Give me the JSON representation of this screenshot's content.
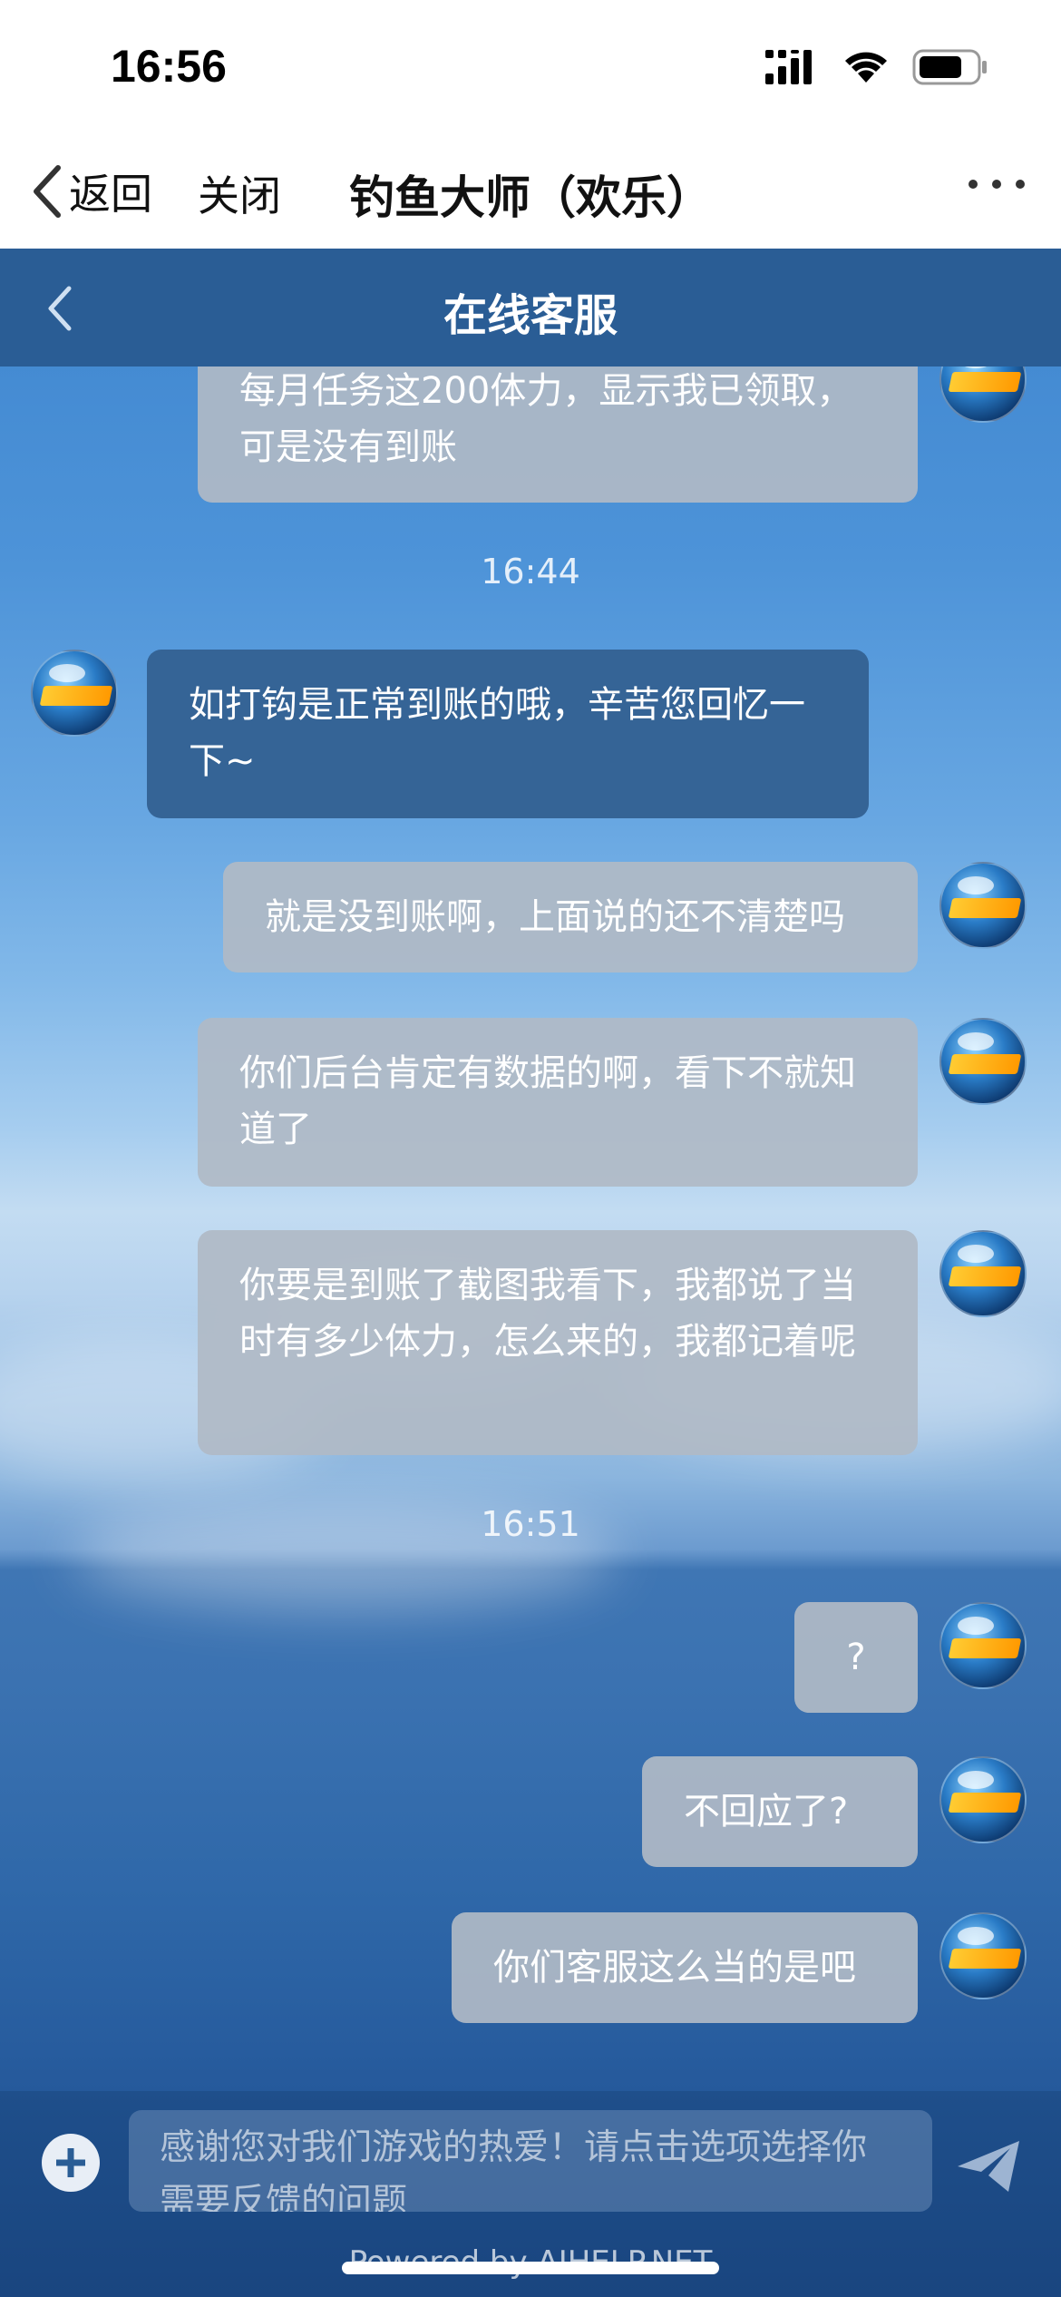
{
  "status_bar": {
    "time": "16:56"
  },
  "nav": {
    "back_label": "返回",
    "close_label": "关闭",
    "title": "钓鱼大师（欢乐）"
  },
  "header": {
    "title": "在线客服"
  },
  "messages": [
    {
      "sender": "user",
      "text": "每月任务这200体力，显示我已领取，可是没有到账"
    },
    {
      "sender": "agent",
      "text": "如打钩是正常到账的哦，辛苦您回忆一下~"
    },
    {
      "sender": "user",
      "text": "就是没到账啊，上面说的还不清楚吗"
    },
    {
      "sender": "user",
      "text": "你们后台肯定有数据的啊，看下不就知道了"
    },
    {
      "sender": "user",
      "text": "你要是到账了截图我看下，我都说了当时有多少体力，怎么来的，我都记着呢"
    },
    {
      "sender": "user",
      "text": "?"
    },
    {
      "sender": "user",
      "text": "不回应了?"
    },
    {
      "sender": "user",
      "text": "你们客服这么当的是吧"
    }
  ],
  "timestamps": [
    "16:44",
    "16:51"
  ],
  "input": {
    "placeholder": "感谢您对我们游戏的热爱！请点击选项选择你需要反馈的问题"
  },
  "footer": {
    "powered_by": "Powered by AIHELP.NET"
  }
}
